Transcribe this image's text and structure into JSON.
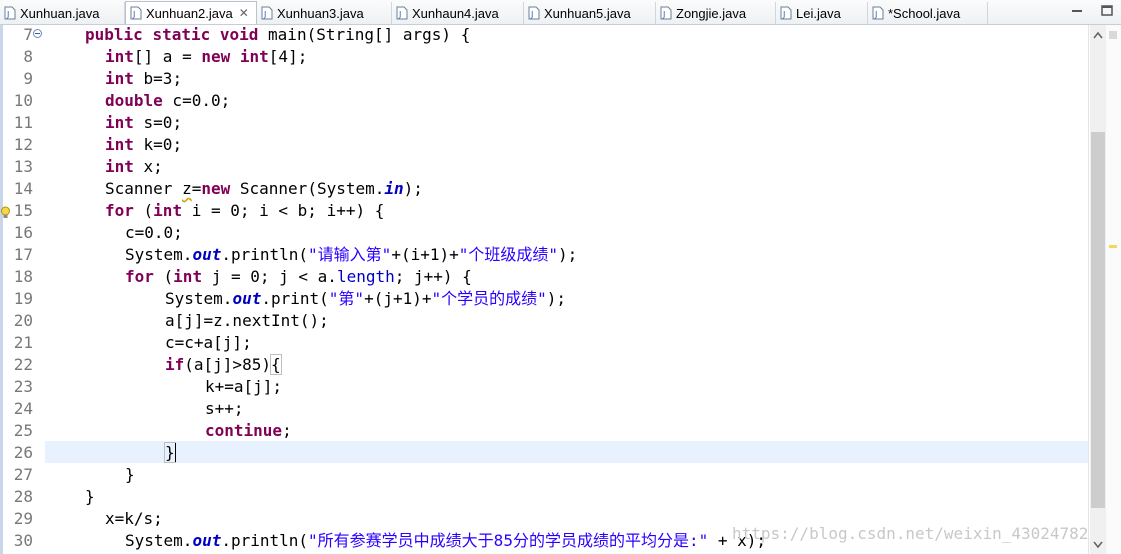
{
  "tabs": [
    {
      "label": "Xunhuan.java"
    },
    {
      "label": "Xunhuan2.java",
      "close": "✕"
    },
    {
      "label": "Xunhuan3.java"
    },
    {
      "label": "Xunhaun4.java"
    },
    {
      "label": "Xunhuan5.java"
    },
    {
      "label": "Zongjie.java"
    },
    {
      "label": "Lei.java"
    },
    {
      "label": "*School.java"
    }
  ],
  "line_numbers": [
    "7",
    "8",
    "9",
    "10",
    "11",
    "12",
    "13",
    "14",
    "15",
    "16",
    "17",
    "18",
    "19",
    "20",
    "21",
    "22",
    "23",
    "24",
    "25",
    "26",
    "27",
    "28",
    "29",
    "30"
  ],
  "code": {
    "l7": [
      "public",
      " ",
      "static",
      " ",
      "void",
      " main(String[] args) {"
    ],
    "l8": [
      "int",
      "[] a = ",
      "new",
      " ",
      "int",
      "[4];"
    ],
    "l9": [
      "int",
      " b=3;"
    ],
    "l10": [
      "double",
      " c=0.0;"
    ],
    "l11": [
      "int",
      " s=0;"
    ],
    "l12": [
      "int",
      " k=0;"
    ],
    "l13": [
      "int",
      " x;"
    ],
    "l14": [
      "Scanner ",
      "z",
      "=",
      "new",
      " Scanner(System.",
      "in",
      ");"
    ],
    "l15": [
      "for",
      " (",
      "int",
      " i = 0; i < b; i++) {"
    ],
    "l16": [
      "c=0.0;"
    ],
    "l17": [
      "System.",
      "out",
      ".println(",
      "\"请输入第\"",
      "+(i+1)+",
      "\"个班级成绩\"",
      ");"
    ],
    "l18": [
      "for",
      " (",
      "int",
      " j = 0; j < a.",
      "length",
      "; j++) {"
    ],
    "l19": [
      "System.",
      "out",
      ".print(",
      "\"第\"",
      "+(j+1)+",
      "\"个学员的成绩\"",
      ");"
    ],
    "l20": [
      "a[j]=z.nextInt();"
    ],
    "l21": [
      "c=c+a[j];"
    ],
    "l22": [
      "if",
      "(a[j]>85)",
      "{"
    ],
    "l23": [
      "k+=a[j];"
    ],
    "l24": [
      "s++;"
    ],
    "l25": [
      "continue",
      ";"
    ],
    "l26": [
      "}"
    ],
    "l27": [
      "}"
    ],
    "l28": [
      "}"
    ],
    "l29": [
      "x=k/s;"
    ],
    "l30": [
      "System.",
      "out",
      ".println(",
      "\"所有参赛学员中成绩大于85分的学员成绩的平均分是:\"",
      " + x);"
    ]
  },
  "watermark": "https://blog.csdn.net/weixin_43024782",
  "colors": {
    "keyword": "#7f0055",
    "string": "#2a00ff",
    "field": "#0000c0",
    "current_line": "#e8f2fe",
    "line_number": "#787878"
  },
  "icons": {
    "tab": "java-file-icon",
    "gutter_marker": "warning-lightbulb-icon"
  }
}
